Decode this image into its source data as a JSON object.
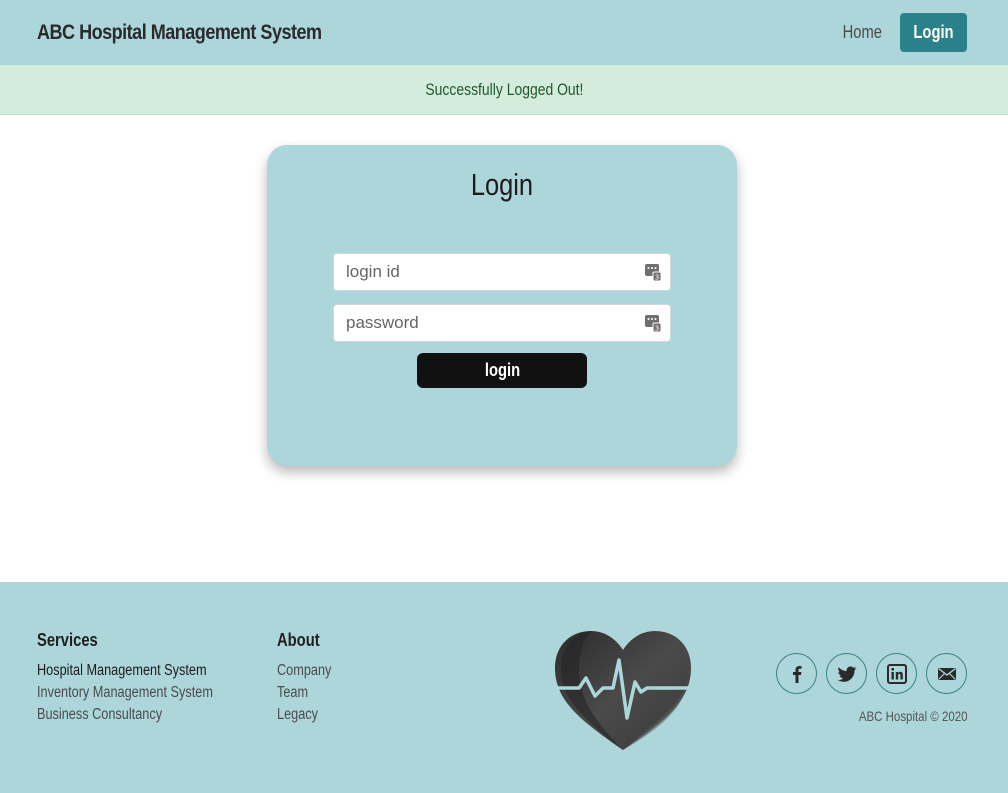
{
  "header": {
    "brand": "ABC Hospital Management System",
    "home_label": "Home",
    "login_label": "Login"
  },
  "alert": {
    "message": "Successfully Logged Out!"
  },
  "login_form": {
    "title": "Login",
    "login_id_placeholder": "login id",
    "password_placeholder": "password",
    "submit_label": "login"
  },
  "footer": {
    "services": {
      "heading": "Services",
      "items": [
        "Hospital Management System",
        "Inventory Management System",
        "Business Consultancy"
      ]
    },
    "about": {
      "heading": "About",
      "items": [
        "Company",
        "Team",
        "Legacy"
      ]
    },
    "social_icons": [
      "facebook-icon",
      "twitter-icon",
      "linkedin-icon",
      "email-icon"
    ],
    "copyright": "ABC Hospital © 2020"
  },
  "colors": {
    "header_bg": "#acd6da",
    "accent": "#2b8189",
    "alert_bg": "#d4ecdb",
    "alert_text": "#1f5a2e",
    "button_dark": "#111111"
  }
}
